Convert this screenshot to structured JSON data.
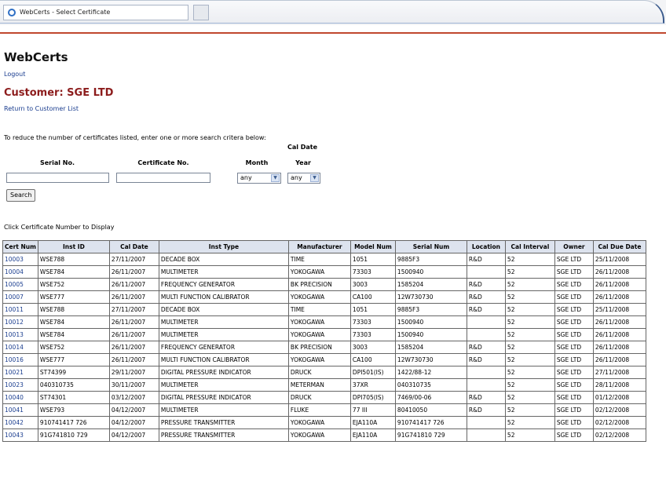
{
  "browser": {
    "tab_title": "WebCerts - Select Certificate"
  },
  "app": {
    "title": "WebCerts",
    "logout": "Logout"
  },
  "customer": {
    "heading": "Customer: SGE LTD",
    "return_link": "Return to Customer List"
  },
  "search": {
    "instructions": "To reduce the number of certificates listed, enter one or more search critera below:",
    "serial_label": "Serial No.",
    "certificate_label": "Certificate No.",
    "cal_date_label": "Cal Date",
    "month_label": "Month",
    "year_label": "Year",
    "month_value": "any",
    "year_value": "any",
    "button": "Search",
    "serial_value": "",
    "certificate_value": ""
  },
  "table": {
    "hint": "Click Certificate Number to Display",
    "columns": [
      "Cert Num",
      "Inst ID",
      "Cal Date",
      "Inst Type",
      "Manufacturer",
      "Model Num",
      "Serial Num",
      "Location",
      "Cal Interval",
      "Owner",
      "Cal Due Date"
    ],
    "rows": [
      [
        "10003",
        "WSE788",
        "27/11/2007",
        "DECADE BOX",
        "TIME",
        "1051",
        "9885F3",
        "R&D",
        "52",
        "SGE LTD",
        "25/11/2008"
      ],
      [
        "10004",
        "WSE784",
        "26/11/2007",
        "MULTIMETER",
        "YOKOGAWA",
        "73303",
        "1500940",
        "",
        "52",
        "SGE LTD",
        "26/11/2008"
      ],
      [
        "10005",
        "WSE752",
        "26/11/2007",
        "FREQUENCY GENERATOR",
        "BK PRECISION",
        "3003",
        "1585204",
        "R&D",
        "52",
        "SGE LTD",
        "26/11/2008"
      ],
      [
        "10007",
        "WSE777",
        "26/11/2007",
        "MULTI FUNCTION CALIBRATOR",
        "YOKOGAWA",
        "CA100",
        "12W730730",
        "R&D",
        "52",
        "SGE LTD",
        "26/11/2008"
      ],
      [
        "10011",
        "WSE788",
        "27/11/2007",
        "DECADE BOX",
        "TIME",
        "1051",
        "9885F3",
        "R&D",
        "52",
        "SGE LTD",
        "25/11/2008"
      ],
      [
        "10012",
        "WSE784",
        "26/11/2007",
        "MULTIMETER",
        "YOKOGAWA",
        "73303",
        "1500940",
        "",
        "52",
        "SGE LTD",
        "26/11/2008"
      ],
      [
        "10013",
        "WSE784",
        "26/11/2007",
        "MULTIMETER",
        "YOKOGAWA",
        "73303",
        "1500940",
        "",
        "52",
        "SGE LTD",
        "26/11/2008"
      ],
      [
        "10014",
        "WSE752",
        "26/11/2007",
        "FREQUENCY GENERATOR",
        "BK PRECISION",
        "3003",
        "1585204",
        "R&D",
        "52",
        "SGE LTD",
        "26/11/2008"
      ],
      [
        "10016",
        "WSE777",
        "26/11/2007",
        "MULTI FUNCTION CALIBRATOR",
        "YOKOGAWA",
        "CA100",
        "12W730730",
        "R&D",
        "52",
        "SGE LTD",
        "26/11/2008"
      ],
      [
        "10021",
        "ST74399",
        "29/11/2007",
        "DIGITAL PRESSURE INDICATOR",
        "DRUCK",
        "DPI501(IS)",
        "1422/88-12",
        "",
        "52",
        "SGE LTD",
        "27/11/2008"
      ],
      [
        "10023",
        "040310735",
        "30/11/2007",
        "MULTIMETER",
        "METERMAN",
        "37XR",
        "040310735",
        "",
        "52",
        "SGE LTD",
        "28/11/2008"
      ],
      [
        "10040",
        "ST74301",
        "03/12/2007",
        "DIGITAL PRESSURE INDICATOR",
        "DRUCK",
        "DPI705(IS)",
        "7469/00-06",
        "R&D",
        "52",
        "SGE LTD",
        "01/12/2008"
      ],
      [
        "10041",
        "WSE793",
        "04/12/2007",
        "MULTIMETER",
        "FLUKE",
        "77 III",
        "80410050",
        "R&D",
        "52",
        "SGE LTD",
        "02/12/2008"
      ],
      [
        "10042",
        "910741417 726",
        "04/12/2007",
        "PRESSURE TRANSMITTER",
        "YOKOGAWA",
        "EJA110A",
        "910741417 726",
        "",
        "52",
        "SGE LTD",
        "02/12/2008"
      ],
      [
        "10043",
        "91G741810 729",
        "04/12/2007",
        "PRESSURE TRANSMITTER",
        "YOKOGAWA",
        "EJA110A",
        "91G741810 729",
        "",
        "52",
        "SGE LTD",
        "02/12/2008"
      ]
    ]
  }
}
